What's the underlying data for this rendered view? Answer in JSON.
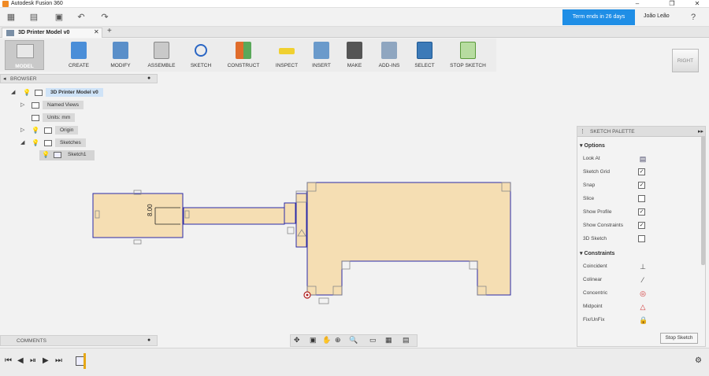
{
  "window": {
    "title": "Autodesk Fusion 360"
  },
  "trial_banner": "Term ends in 26 days",
  "user_name": "João Leão",
  "document_tab": {
    "title": "3D Printer Model v0"
  },
  "toolbar": {
    "model": "MODEL",
    "create": "CREATE",
    "modify": "MODIFY",
    "assemble": "ASSEMBLE",
    "sketch": "SKETCH",
    "construct": "CONSTRUCT",
    "inspect": "INSPECT",
    "insert": "INSERT",
    "make": "MAKE",
    "addins": "ADD-INS",
    "select": "SELECT",
    "stop_sketch": "STOP SKETCH"
  },
  "viewcube_label": "RIGHT",
  "browser": {
    "title": "BROWSER",
    "root": "3D Printer Model v0",
    "items": [
      {
        "label": "Named Views"
      },
      {
        "label": "Units: mm"
      },
      {
        "label": "Origin"
      },
      {
        "label": "Sketches"
      },
      {
        "label": "Sketch1"
      }
    ]
  },
  "comments": {
    "title": "COMMENTS"
  },
  "sketch": {
    "dimension": "8.00"
  },
  "palette": {
    "title": "SKETCH PALETTE",
    "options_header": "Options",
    "options": [
      {
        "label": "Look At"
      },
      {
        "label": "Sketch Grid",
        "checked": true
      },
      {
        "label": "Snap",
        "checked": true
      },
      {
        "label": "Slice",
        "checked": false
      },
      {
        "label": "Show Profile",
        "checked": true
      },
      {
        "label": "Show Constraints",
        "checked": true
      },
      {
        "label": "3D Sketch",
        "checked": false
      }
    ],
    "constraints_header": "Constraints",
    "constraints": [
      {
        "label": "Coincident"
      },
      {
        "label": "Colinear"
      },
      {
        "label": "Concentric"
      },
      {
        "label": "Midpoint"
      },
      {
        "label": "Fix/UnFix"
      }
    ],
    "stop_sketch": "Stop Sketch"
  },
  "colors": {
    "accent": "#1f8ee6",
    "sketch_fill": "#f5deb3",
    "sketch_line": "#2a2aa8"
  }
}
